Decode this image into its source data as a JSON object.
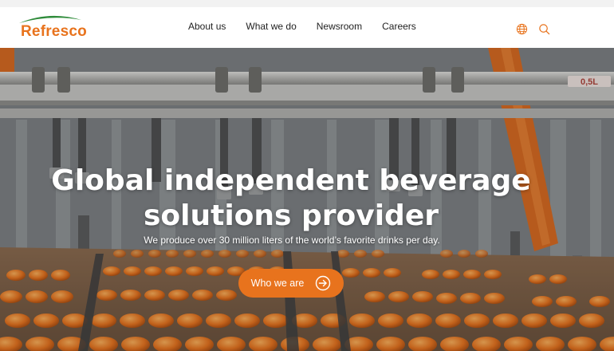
{
  "brand": {
    "name": "Refresco",
    "accent": "#e8731d",
    "swoosh": "#2e8b3a"
  },
  "nav": {
    "links": [
      {
        "label": "About us"
      },
      {
        "label": "What we do"
      },
      {
        "label": "Newsroom"
      },
      {
        "label": "Careers"
      }
    ],
    "icons": [
      "globe-icon",
      "search-icon"
    ]
  },
  "hero": {
    "machine_label": "0,5L",
    "headline_line1": "Global independent beverage",
    "headline_line2": "solutions provider",
    "subline": "We produce over 30 million liters of the world’s favorite drinks per day.",
    "cta_label": "Who we are",
    "cta_icon": "arrow-right-circle-icon"
  }
}
